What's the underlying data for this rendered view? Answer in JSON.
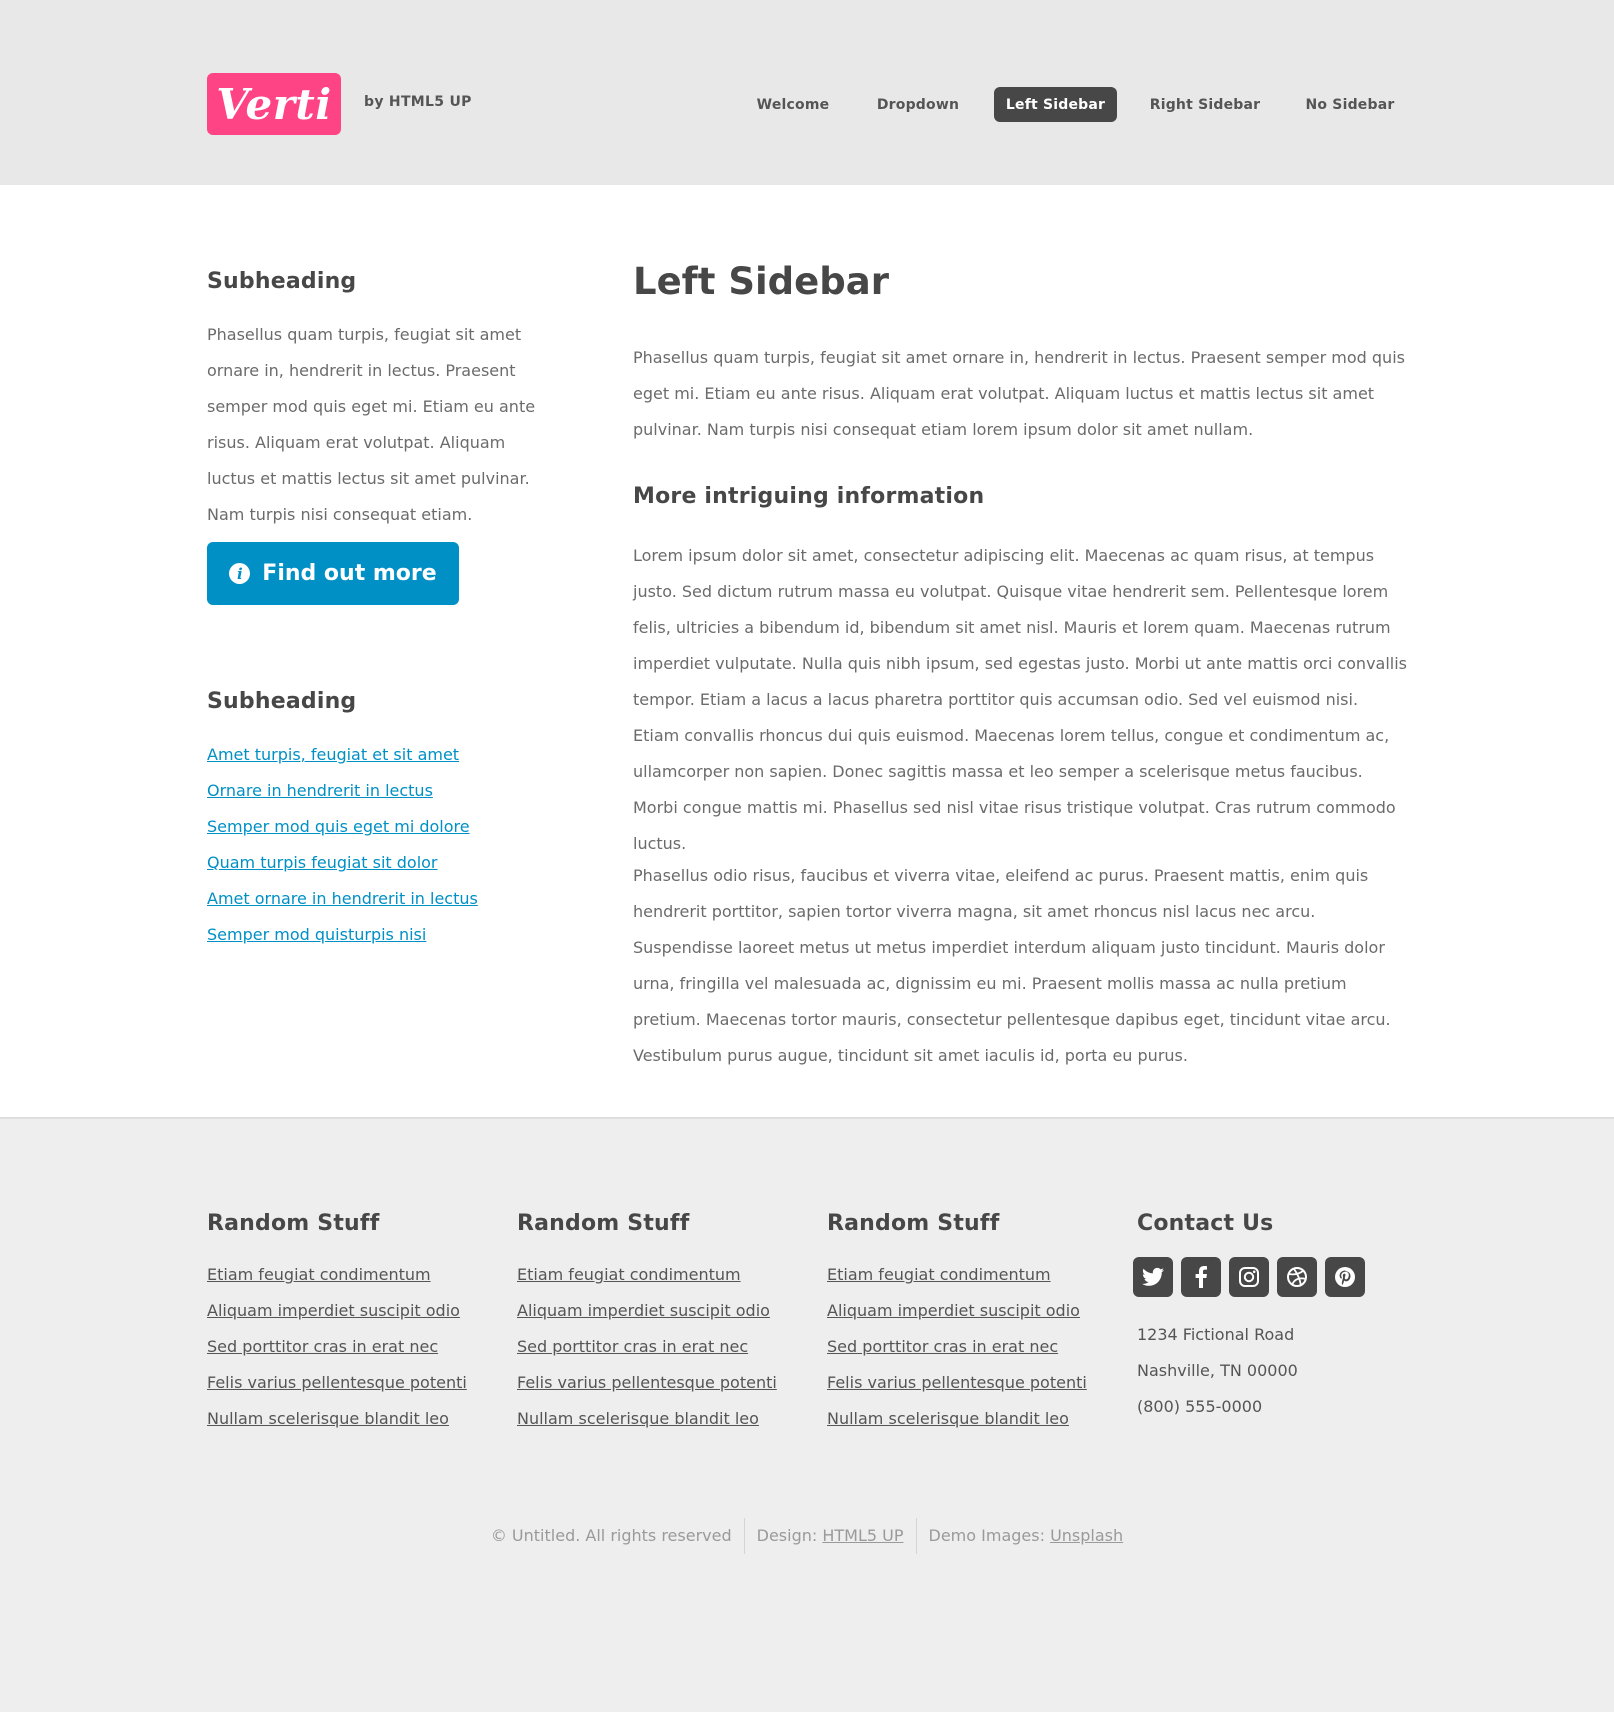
{
  "header": {
    "logo": "Verti",
    "byline": "by HTML5 UP",
    "nav": [
      {
        "label": "Welcome"
      },
      {
        "label": "Dropdown"
      },
      {
        "label": "Left Sidebar"
      },
      {
        "label": "Right Sidebar"
      },
      {
        "label": "No Sidebar"
      }
    ],
    "active_nav": "Left Sidebar"
  },
  "sidebar": {
    "section1": {
      "heading": "Subheading",
      "text": "Phasellus quam turpis, feugiat sit amet ornare in, hendrerit in lectus. Praesent semper mod quis eget mi. Etiam eu ante risus. Aliquam erat volutpat. Aliquam luctus et mattis lectus sit amet pulvinar. Nam turpis nisi consequat etiam.",
      "button_label": "Find out more",
      "button_icon": "info-circle-icon"
    },
    "section2": {
      "heading": "Subheading",
      "links": [
        "Amet turpis, feugiat et sit amet",
        "Ornare in hendrerit in lectus",
        "Semper mod quis eget mi dolore",
        "Quam turpis feugiat sit dolor",
        "Amet ornare in hendrerit in lectus",
        "Semper mod quisturpis nisi"
      ]
    }
  },
  "content": {
    "title": "Left Sidebar",
    "intro": "Phasellus quam turpis, feugiat sit amet ornare in, hendrerit in lectus. Praesent semper mod quis eget mi. Etiam eu ante risus. Aliquam erat volutpat. Aliquam luctus et mattis lectus sit amet pulvinar. Nam turpis nisi consequat etiam lorem ipsum dolor sit amet nullam.",
    "subheading": "More intriguing information",
    "para1": "Lorem ipsum dolor sit amet, consectetur adipiscing elit. Maecenas ac quam risus, at tempus justo. Sed dictum rutrum massa eu volutpat. Quisque vitae hendrerit sem. Pellentesque lorem felis, ultricies a bibendum id, bibendum sit amet nisl. Mauris et lorem quam. Maecenas rutrum imperdiet vulputate. Nulla quis nibh ipsum, sed egestas justo. Morbi ut ante mattis orci convallis tempor. Etiam a lacus a lacus pharetra porttitor quis accumsan odio. Sed vel euismod nisi. Etiam convallis rhoncus dui quis euismod. Maecenas lorem tellus, congue et condimentum ac, ullamcorper non sapien. Donec sagittis massa et leo semper a scelerisque metus faucibus. Morbi congue mattis mi. Phasellus sed nisl vitae risus tristique volutpat. Cras rutrum commodo luctus.",
    "para2": "Phasellus odio risus, faucibus et viverra vitae, eleifend ac purus. Praesent mattis, enim quis hendrerit porttitor, sapien tortor viverra magna, sit amet rhoncus nisl lacus nec arcu. Suspendisse laoreet metus ut metus imperdiet interdum aliquam justo tincidunt. Mauris dolor urna, fringilla vel malesuada ac, dignissim eu mi. Praesent mollis massa ac nulla pretium pretium. Maecenas tortor mauris, consectetur pellentesque dapibus eget, tincidunt vitae arcu. Vestibulum purus augue, tincidunt sit amet iaculis id, porta eu purus."
  },
  "footer": {
    "columns": [
      {
        "heading": "Random Stuff",
        "links": [
          "Etiam feugiat condimentum",
          "Aliquam imperdiet suscipit odio",
          "Sed porttitor cras in erat nec",
          "Felis varius pellentesque potenti",
          "Nullam scelerisque blandit leo"
        ]
      },
      {
        "heading": "Random Stuff",
        "links": [
          "Etiam feugiat condimentum",
          "Aliquam imperdiet suscipit odio",
          "Sed porttitor cras in erat nec",
          "Felis varius pellentesque potenti",
          "Nullam scelerisque blandit leo"
        ]
      },
      {
        "heading": "Random Stuff",
        "links": [
          "Etiam feugiat condimentum",
          "Aliquam imperdiet suscipit odio",
          "Sed porttitor cras in erat nec",
          "Felis varius pellentesque potenti",
          "Nullam scelerisque blandit leo"
        ]
      }
    ],
    "contact": {
      "heading": "Contact Us",
      "social": [
        "twitter-icon",
        "facebook-icon",
        "instagram-icon",
        "dribbble-icon",
        "pinterest-icon"
      ],
      "address1": "1234 Fictional Road",
      "address2": "Nashville, TN 00000",
      "phone": "(800) 555-0000"
    },
    "copyright": {
      "text": "© Untitled. All rights reserved",
      "design_label": "Design:",
      "design_link": "HTML5 UP",
      "images_label": "Demo Images:",
      "images_link": "Unsplash"
    }
  },
  "colors": {
    "brand": "#ff4486",
    "accent": "#0090c5",
    "dark": "#474747"
  }
}
